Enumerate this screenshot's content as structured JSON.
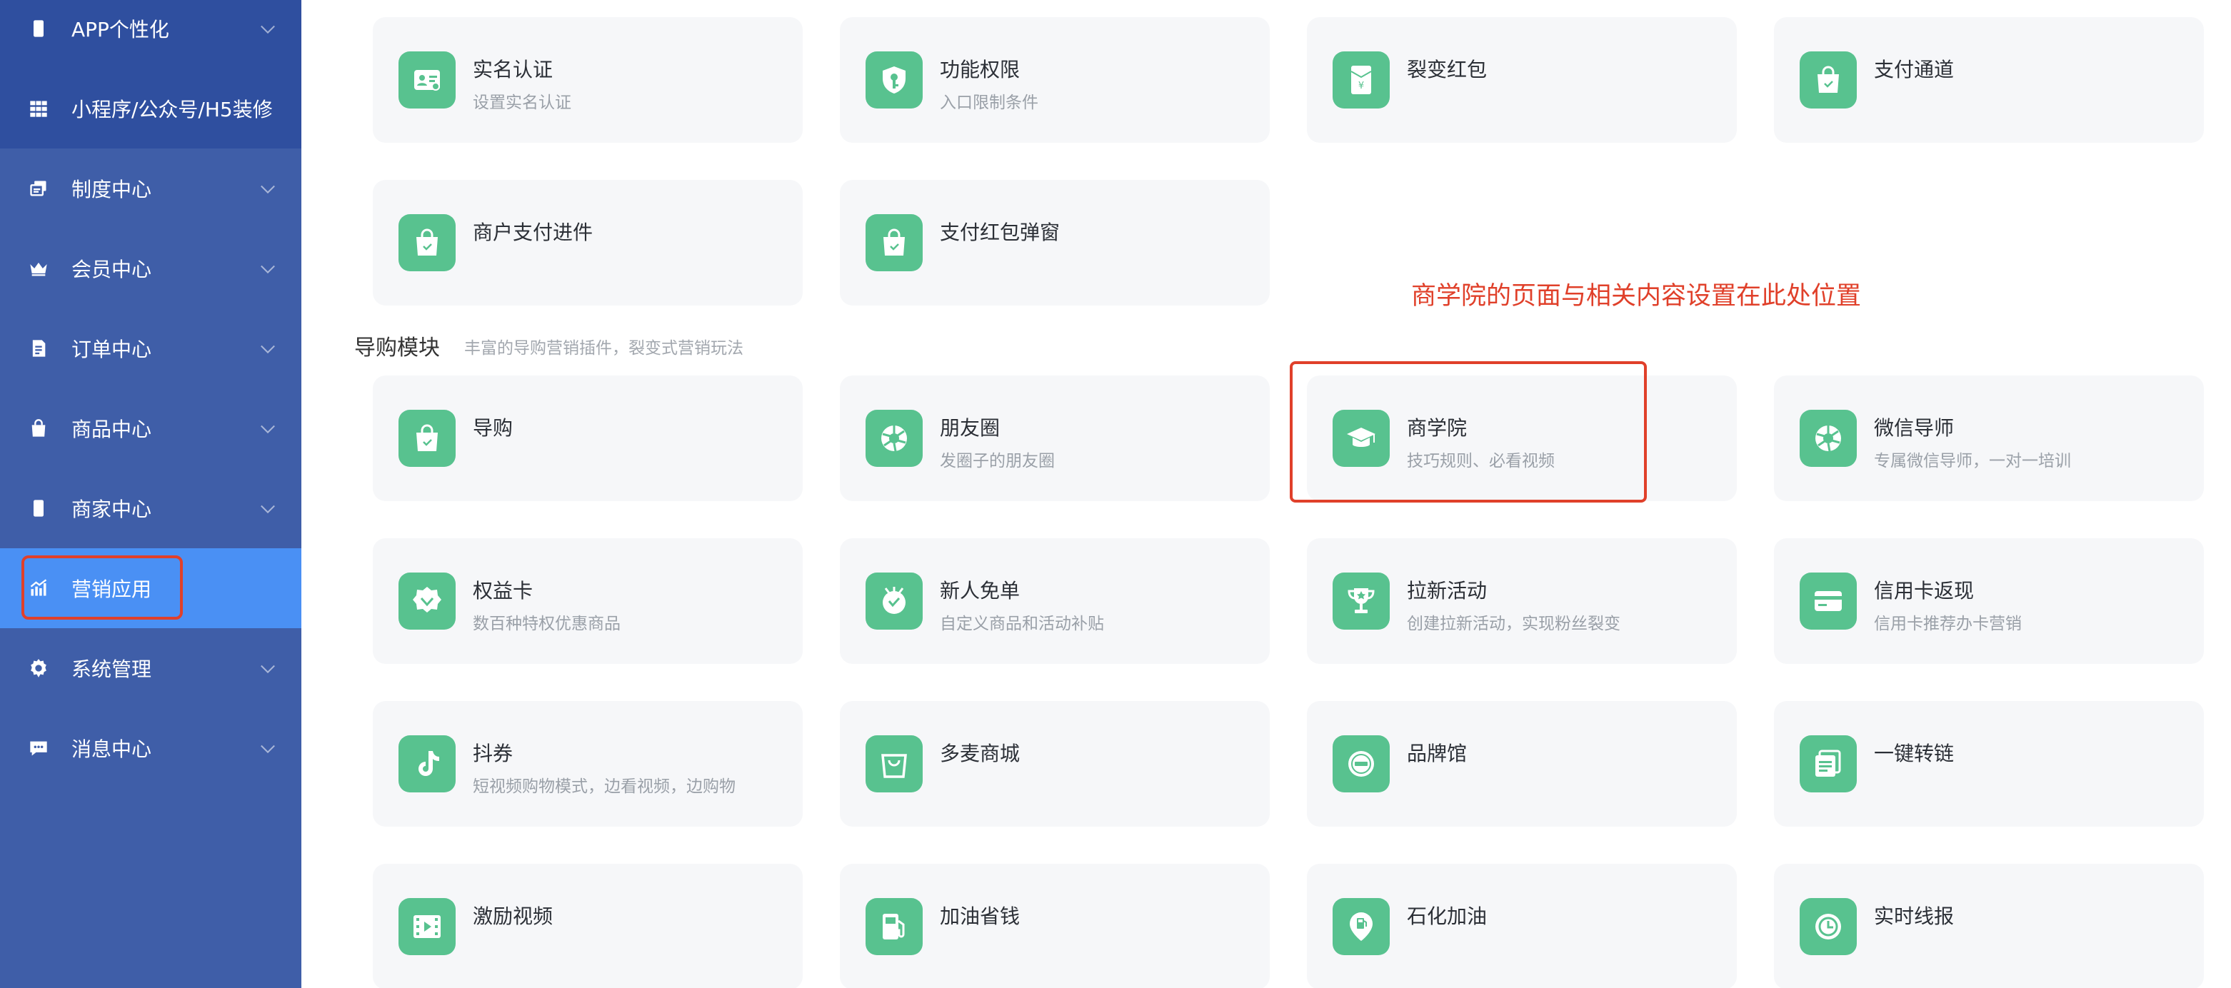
{
  "sidebar": {
    "items": [
      {
        "label": "APP个性化",
        "icon": "phone-icon"
      },
      {
        "label": "小程序/公众号/H5装修",
        "icon": "grid-icon"
      },
      {
        "label": "制度中心",
        "icon": "document-stack-icon"
      },
      {
        "label": "会员中心",
        "icon": "crown-icon"
      },
      {
        "label": "订单中心",
        "icon": "order-doc-icon"
      },
      {
        "label": "商品中心",
        "icon": "shopping-bag-icon"
      },
      {
        "label": "商家中心",
        "icon": "merchant-phone-icon"
      },
      {
        "label": "营销应用",
        "icon": "chart-bars-icon"
      },
      {
        "label": "系统管理",
        "icon": "gear-icon"
      },
      {
        "label": "消息中心",
        "icon": "chat-bubble-icon"
      }
    ]
  },
  "cards_top": [
    {
      "title": "实名认证",
      "desc": "设置实名认证",
      "icon": "id-card-icon"
    },
    {
      "title": "功能权限",
      "desc": "入口限制条件",
      "icon": "shield-key-icon"
    },
    {
      "title": "裂变红包",
      "desc": "",
      "icon": "red-envelope-icon"
    },
    {
      "title": "支付通道",
      "desc": "",
      "icon": "shopping-bag-icon"
    },
    {
      "title": "商户支付进件",
      "desc": "",
      "icon": "shopping-bag-icon"
    },
    {
      "title": "支付红包弹窗",
      "desc": "",
      "icon": "shopping-bag-icon"
    }
  ],
  "annotation": "商学院的页面与相关内容设置在此处位置",
  "section": {
    "title": "导购模块",
    "desc": "丰富的导购营销插件，裂变式营销玩法"
  },
  "cards_guide": [
    {
      "title": "导购",
      "desc": "",
      "icon": "shopping-bag-icon"
    },
    {
      "title": "朋友圈",
      "desc": "发圈子的朋友圈",
      "icon": "aperture-icon"
    },
    {
      "title": "商学院",
      "desc": "技巧规则、必看视频",
      "icon": "graduation-cap-icon"
    },
    {
      "title": "微信导师",
      "desc": "专属微信导师，一对一培训",
      "icon": "aperture-icon"
    },
    {
      "title": "权益卡",
      "desc": "数百种特权优惠商品",
      "icon": "badge-check-icon"
    },
    {
      "title": "新人免单",
      "desc": "自定义商品和活动补贴",
      "icon": "gift-burst-icon"
    },
    {
      "title": "拉新活动",
      "desc": "创建拉新活动，实现粉丝裂变",
      "icon": "trophy-icon"
    },
    {
      "title": "信用卡返现",
      "desc": "信用卡推荐办卡营销",
      "icon": "credit-card-icon"
    },
    {
      "title": "抖券",
      "desc": "短视频购物模式，边看视频，边购物",
      "icon": "music-note-icon"
    },
    {
      "title": "多麦商城",
      "desc": "",
      "icon": "bag-outline-icon"
    },
    {
      "title": "品牌馆",
      "desc": "",
      "icon": "brand-seal-icon"
    },
    {
      "title": "一键转链",
      "desc": "",
      "icon": "copy-link-icon"
    },
    {
      "title": "激励视频",
      "desc": "",
      "icon": "film-icon"
    },
    {
      "title": "加油省钱",
      "desc": "",
      "icon": "fuel-pump-icon"
    },
    {
      "title": "石化加油",
      "desc": "",
      "icon": "fuel-pin-icon"
    },
    {
      "title": "实时线报",
      "desc": "",
      "icon": "clock-icon"
    }
  ],
  "colors": {
    "sidebar_bg": "#3f5ea8",
    "sidebar_active": "#4a90f4",
    "icon_green": "#58c28f",
    "card_bg": "#f6f7f9",
    "annotation_red": "#e0402a"
  }
}
